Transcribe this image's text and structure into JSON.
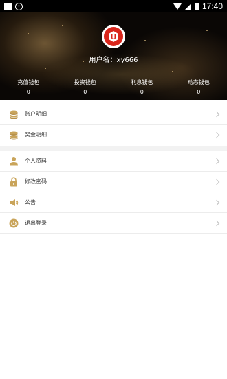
{
  "status_bar": {
    "time": "17:40"
  },
  "profile": {
    "username_label": "用户名：xy666"
  },
  "wallets": [
    {
      "label": "充值钱包",
      "value": "0"
    },
    {
      "label": "投资钱包",
      "value": "0"
    },
    {
      "label": "利息钱包",
      "value": "0"
    },
    {
      "label": "动态钱包",
      "value": "0"
    }
  ],
  "menu_group1": [
    {
      "label": "账户明细",
      "icon": "coin-stack-icon"
    },
    {
      "label": "奖金明细",
      "icon": "coin-stack-icon"
    }
  ],
  "menu_group2": [
    {
      "label": "个人资料",
      "icon": "person-icon"
    },
    {
      "label": "修改密码",
      "icon": "lock-icon"
    },
    {
      "label": "公告",
      "icon": "megaphone-icon"
    },
    {
      "label": "退出登录",
      "icon": "power-icon"
    }
  ],
  "colors": {
    "accent": "#c9a45a",
    "brand_red": "#d9261c",
    "header_bg": "#0a0705"
  }
}
